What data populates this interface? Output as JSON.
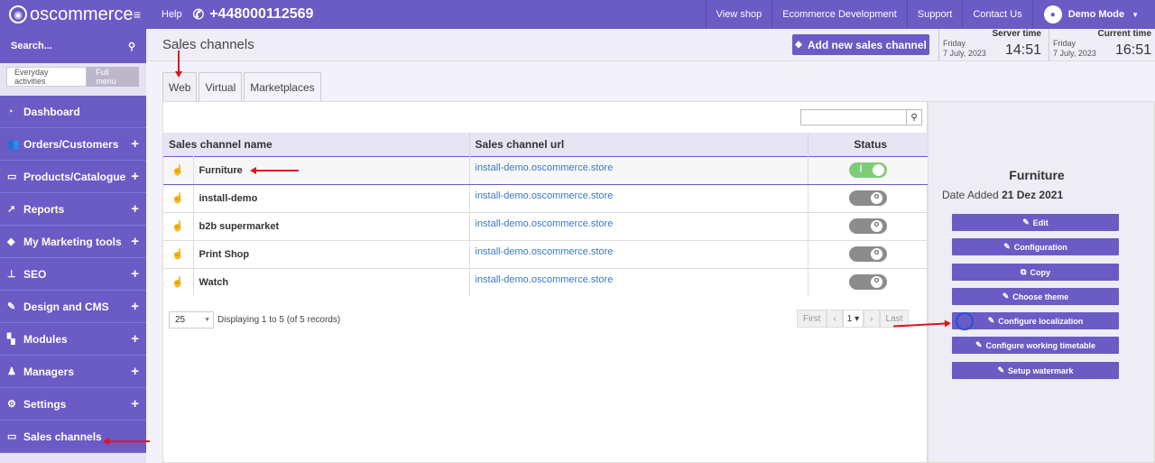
{
  "topbar": {
    "logo_text": "oscommerce",
    "help": "Help",
    "phone": "+448000112569",
    "links": [
      "View shop",
      "Ecommerce Development",
      "Support",
      "Contact Us"
    ],
    "user": "Demo Mode"
  },
  "sidebar": {
    "search_placeholder": "Search...",
    "toggle_everyday": "Everyday activities",
    "toggle_full": "Full menu",
    "items": [
      {
        "label": "Dashboard",
        "icon": "dashboard-icon",
        "expandable": false
      },
      {
        "label": "Orders/Customers",
        "icon": "users-icon",
        "expandable": true
      },
      {
        "label": "Products/Catalogue",
        "icon": "folder-icon",
        "expandable": true
      },
      {
        "label": "Reports",
        "icon": "chart-icon",
        "expandable": true
      },
      {
        "label": "My Marketing tools",
        "icon": "tag-icon",
        "expandable": true
      },
      {
        "label": "SEO",
        "icon": "sitemap-icon",
        "expandable": true
      },
      {
        "label": "Design and CMS",
        "icon": "brush-icon",
        "expandable": true
      },
      {
        "label": "Modules",
        "icon": "puzzle-icon",
        "expandable": true
      },
      {
        "label": "Managers",
        "icon": "user-icon",
        "expandable": true
      },
      {
        "label": "Settings",
        "icon": "gears-icon",
        "expandable": true
      },
      {
        "label": "Sales channels",
        "icon": "monitor-icon",
        "expandable": false
      }
    ]
  },
  "header": {
    "title": "Sales channels",
    "add_button": "Add new sales channel",
    "server_time": {
      "label": "Server time",
      "day": "Friday",
      "date": "7 July, 2023",
      "time": "14:51"
    },
    "current_time": {
      "label": "Current time",
      "day": "Friday",
      "date": "7 July, 2023",
      "time": "16:51"
    }
  },
  "tabs": [
    "Web",
    "Virtual",
    "Marketplaces"
  ],
  "table": {
    "columns": [
      "Sales channel name",
      "Sales channel url",
      "Status"
    ],
    "rows": [
      {
        "name": "Furniture",
        "url": "install-demo.oscommerce.store",
        "status": "on"
      },
      {
        "name": "install-demo",
        "url": "install-demo.oscommerce.store",
        "status": "off"
      },
      {
        "name": "b2b supermarket",
        "url": "install-demo.oscommerce.store",
        "status": "off"
      },
      {
        "name": "Print Shop",
        "url": "install-demo.oscommerce.store",
        "status": "off"
      },
      {
        "name": "Watch",
        "url": "install-demo.oscommerce.store",
        "status": "off"
      }
    ]
  },
  "pager": {
    "per_page": "25",
    "info": "Displaying 1 to 5 (of 5 records)",
    "first": "First",
    "last": "Last",
    "page": "1"
  },
  "detail": {
    "title": "Furniture",
    "date_label": "Date Added",
    "date_value": "21 Dez 2021",
    "actions": [
      "Edit",
      "Configuration",
      "Copy",
      "Choose theme",
      "Configure localization",
      "Configure working timetable",
      "Setup watermark"
    ]
  },
  "colors": {
    "accent": "#6a5bc5",
    "switch_on": "#7ecb78",
    "annotation": "#e0141e"
  }
}
